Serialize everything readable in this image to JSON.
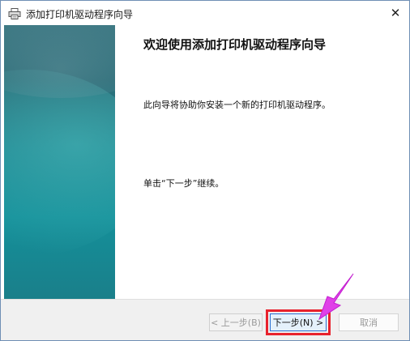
{
  "window": {
    "title": "添加打印机驱动程序向导"
  },
  "content": {
    "heading": "欢迎使用添加打印机驱动程序向导",
    "description": "此向导将协助你安装一个新的打印机驱动程序。",
    "hint": "单击“下一步”继续。"
  },
  "buttons": {
    "back_label": "< 上一步(B)",
    "next_label": "下一步(N) >",
    "cancel_label": "取消"
  },
  "icons": {
    "title": "printer-icon",
    "close": "close-icon",
    "pointer": "arrow-pointer-icon"
  },
  "colors": {
    "highlight": "#e8222d",
    "arrow": "#e040e8",
    "sidebar": "#1d848f"
  }
}
